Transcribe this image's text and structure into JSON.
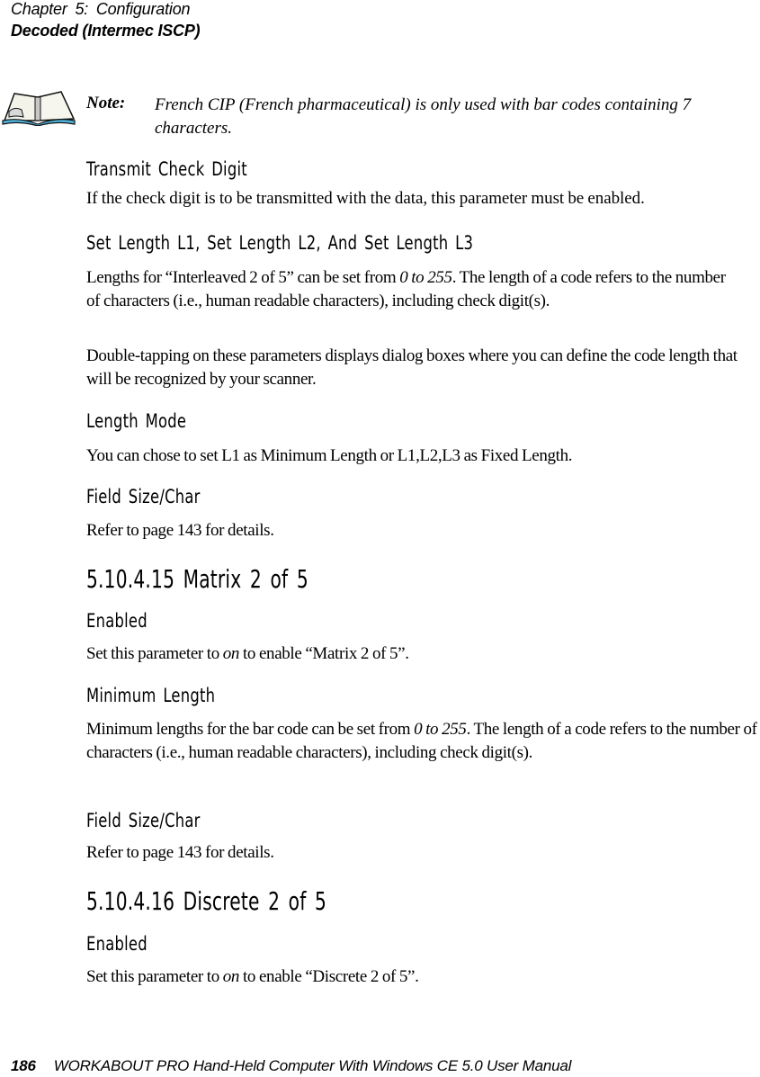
{
  "header": {
    "chapter": "Chapter  5:  Configuration",
    "section": "Decoded (Intermec ISCP)"
  },
  "note": {
    "icon": "open-book-icon",
    "label": "Note:",
    "text": "French CIP (French pharmaceutical) is only used with bar codes containing 7 characters."
  },
  "sections": {
    "transmit_check_digit": {
      "heading": "Transmit Check Digit",
      "body": "If the check digit is to be transmitted with the data, this parameter must be enabled."
    },
    "set_length": {
      "heading": "Set Length L1, Set Length L2, And Set Length L3",
      "body1_pre": "Lengths for “Interleaved 2 of 5” can be set from ",
      "body1_em": "0 to 255",
      "body1_post": ". The length of a code refers to the number of characters (i.e., human readable characters), including check digit(s).",
      "body2": "Double-tapping on these parameters displays dialog boxes where you can define the code length that will be recognized by your scanner."
    },
    "length_mode": {
      "heading": "Length Mode",
      "body": "You can chose to set L1 as Minimum Length or L1,L2,L3 as Fixed Length."
    },
    "field_size_1": {
      "heading": "Field Size/Char",
      "body": "Refer to page 143 for details."
    },
    "matrix": {
      "heading": "5.10.4.15  Matrix 2 of 5",
      "enabled_heading": "Enabled",
      "enabled_pre": "Set this parameter to ",
      "enabled_em": "on",
      "enabled_post": " to enable “Matrix 2 of 5”."
    },
    "minimum_length": {
      "heading": "Minimum Length",
      "body_pre": "Minimum lengths for the bar code can be set from ",
      "body_em": "0 to 255",
      "body_post": ". The length of a code refers to the number of characters (i.e., human readable characters), including check digit(s)."
    },
    "field_size_2": {
      "heading": "Field Size/Char",
      "body": "Refer to page 143 for details."
    },
    "discrete": {
      "heading": "5.10.4.16  Discrete 2 of 5",
      "enabled_heading": "Enabled",
      "enabled_pre": "Set this parameter to ",
      "enabled_em": "on",
      "enabled_post": " to enable “Discrete 2 of 5”."
    }
  },
  "footer": {
    "page_number": "186",
    "title": "WORKABOUT PRO Hand-Held Computer With Windows CE 5.0 User Manual"
  }
}
